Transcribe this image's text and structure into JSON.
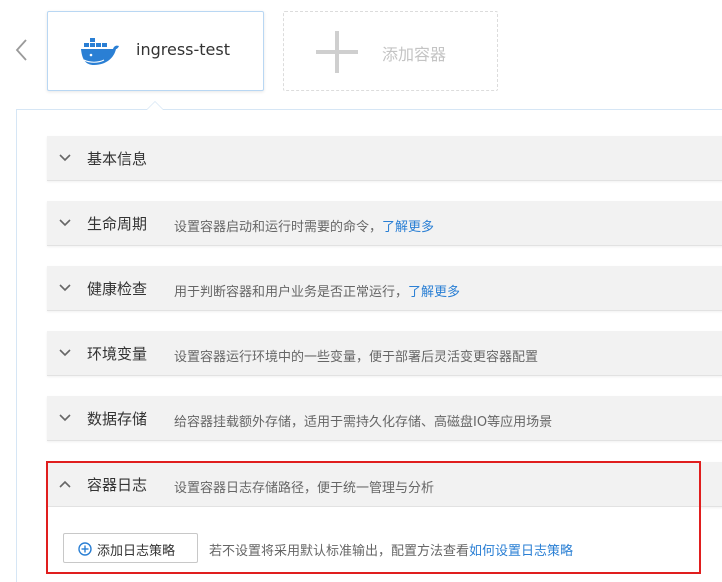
{
  "container_tabs": {
    "active": {
      "name": "ingress-test",
      "icon": "docker-whale-icon"
    },
    "add_label": "添加容器"
  },
  "colors": {
    "accent": "#2a7fd4",
    "highlight": "#e01e1e",
    "section_bg": "#f2f2f2"
  },
  "sections": [
    {
      "title": "基本信息",
      "desc": "",
      "link": "",
      "expanded": false
    },
    {
      "title": "生命周期",
      "desc": "设置容器启动和运行时需要的命令，",
      "link": "了解更多",
      "expanded": false
    },
    {
      "title": "健康检查",
      "desc": "用于判断容器和用户业务是否正常运行，",
      "link": "了解更多",
      "expanded": false
    },
    {
      "title": "环境变量",
      "desc": "设置容器运行环境中的一些变量，便于部署后灵活变更容器配置",
      "link": "",
      "expanded": false
    },
    {
      "title": "数据存储",
      "desc": "给容器挂载额外存储，适用于需持久化存储、高磁盘IO等应用场景",
      "link": "",
      "expanded": false
    },
    {
      "title": "容器日志",
      "desc": "设置容器日志存储路径，便于统一管理与分析",
      "link": "",
      "expanded": true
    }
  ],
  "log_policy": {
    "button_label": "添加日志策略",
    "hint": "若不设置将采用默认标准输出，配置方法查看",
    "hint_link": "如何设置日志策略"
  }
}
